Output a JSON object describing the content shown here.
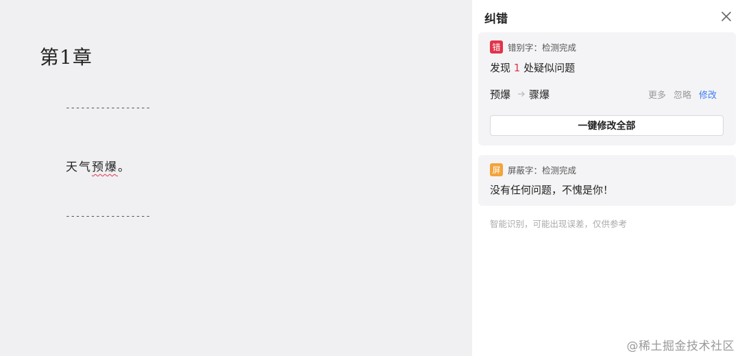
{
  "editor": {
    "chapter_title": "第1章",
    "dash_top": "-----------------",
    "body_prefix": "天气",
    "body_error": "预爆",
    "body_suffix": "。",
    "dash_bottom": "-----------------"
  },
  "panel": {
    "title": "纠错",
    "error_card": {
      "tag": "错",
      "status": "错别字：检测完成",
      "summary_prefix": "发现 ",
      "summary_count": "1",
      "summary_suffix": " 处疑似问题",
      "original": "预爆",
      "suggestion": "骤爆",
      "more_label": "更多",
      "ignore_label": "忽略",
      "fix_label": "修改",
      "fix_all_label": "一键修改全部"
    },
    "mask_card": {
      "tag": "屏",
      "status": "屏蔽字：检测完成",
      "summary": "没有任何问题，不愧是你！"
    },
    "disclaimer": "智能识别，可能出现误差，仅供参考"
  },
  "watermark": "@稀土掘金技术社区",
  "colors": {
    "accent_blue": "#3a7cf0",
    "error_red": "#e0344b",
    "mask_orange": "#f2a33a"
  }
}
